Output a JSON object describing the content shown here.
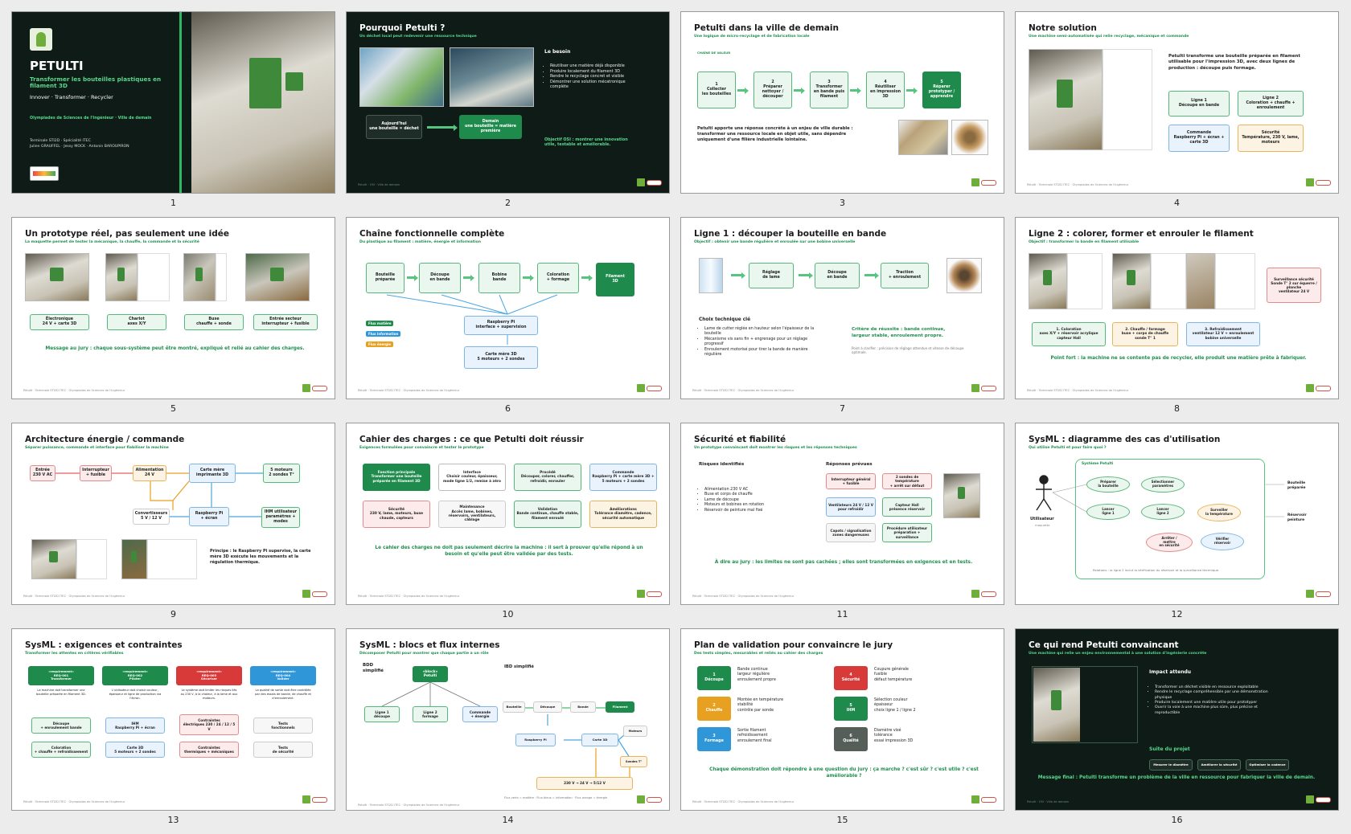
{
  "footer": "Petulti · Terminale STI2D ITEC · Olympiades de Sciences de l'Ingénieur",
  "slides": [
    {
      "num": "1",
      "title": "PETULTI",
      "subtitle": "Transformer les bouteilles plastiques en filament 3D",
      "tagline": "Innover · Transformer · Recycler",
      "event": "Olympiades de Sciences de l'Ingénieur · Ville de demain",
      "class": "Terminale STI2D · Spécialité ITEC",
      "authors": "Julien GRAUFFEL · Jessy MOCK · Antonin BAROUPIRON"
    },
    {
      "num": "2",
      "title": "Pourquoi Petulti ?",
      "subtitle": "Un déchet local peut redevenir une ressource technique",
      "need_title": "Le besoin",
      "need": [
        "Réutiliser une matière déjà disponible",
        "Produire localement du filament 3D",
        "Rendre le recyclage concret et visible",
        "Démontrer une solution mécatronique complète"
      ],
      "today": "Aujourd'hui\nune bouteille = déchet",
      "tomorrow": "Demain\nune bouteille = matière première",
      "osi": "Objectif OSI : montrer une innovation utile, testable et améliorable."
    },
    {
      "num": "3",
      "title": "Petulti dans la ville de demain",
      "subtitle": "Une logique de micro-recyclage et de fabrication locale",
      "chain_label": "CHAÎNE DE VALEUR",
      "steps": [
        "1\nCollecter\nles bouteilles",
        "2\nPréparer\nnettoyer / découper",
        "3\nTransformer\nen bande puis filament",
        "4\nRéutiliser\nen impression 3D",
        "5\nRéparer\nprototyper / apprendre"
      ],
      "text": "Petulti apporte une réponse concrète à un enjeu de ville durable : transformer une ressource locale en objet utile, sans dépendre uniquement d'une filière industrielle lointaine."
    },
    {
      "num": "4",
      "title": "Notre solution",
      "subtitle": "Une machine semi-automatisée qui relie recyclage, mécanique et commande",
      "text": "Petulti transforme une bouteille préparée en filament utilisable pour l'impression 3D, avec deux lignes de production : découpe puis formage.",
      "boxes": [
        "Ligne 1\nDécoupe en bande",
        "Ligne 2\nColoration + chauffe + enroulement",
        "Commande\nRaspberry Pi + écran + carte 3D",
        "Sécurité\nTempérature, 230 V, lame, moteurs"
      ]
    },
    {
      "num": "5",
      "title": "Un prototype réel, pas seulement une idée",
      "subtitle": "La maquette permet de tester la mécanique, la chauffe, la commande et la sécurité",
      "captions": [
        "Électronique\n24 V + carte 3D",
        "Chariot\naxes X/Y",
        "Buse\nchauffe + sonde",
        "Entrée secteur\ninterrupteur + fusible"
      ],
      "message": "Message au jury : chaque sous-système peut être montré, expliqué et relié au cahier des charges."
    },
    {
      "num": "6",
      "title": "Chaîne fonctionnelle complète",
      "subtitle": "Du plastique au filament : matière, énergie et information",
      "steps": [
        "Bouteille\npréparée",
        "Découpe\nen bande",
        "Bobine\nbande",
        "Coloration\n+ formage",
        "Filament\n3D"
      ],
      "rpi": "Raspberry Pi\ninterface + supervision",
      "card": "Carte mère 3D\n5 moteurs + 2 sondes",
      "legend": [
        "Flux matière",
        "Flux information",
        "Flux énergie"
      ]
    },
    {
      "num": "7",
      "title": "Ligne 1 : découper la bouteille en bande",
      "subtitle": "Objectif : obtenir une bande régulière et enroulée sur une bobine universelle",
      "steps": [
        "Réglage\nde lame",
        "Découpe\nen bande",
        "Traction\n+ enroulement"
      ],
      "choice_title": "Choix technique clé",
      "choices": [
        "Lame de cutter réglée en hauteur selon l'épaisseur de la bouteille",
        "Mécanisme vis sans fin + engrenage pour un réglage progressif",
        "Enroulement motorisé pour tirer la bande de manière régulière"
      ],
      "criterion": "Critère de réussite : bande continue, largeur stable, enroulement propre.",
      "clarify": "Point à clarifier : précision de réglage attendue et vitesse de découpe optimale."
    },
    {
      "num": "8",
      "title": "Ligne 2 : colorer, former et enrouler le filament",
      "subtitle": "Objectif : transformer la bande en filament utilisable",
      "captions": [
        "1. Coloration\naxes X/Y + réservoir acrylique\ncapteur Hall",
        "2. Chauffe / formage\nbuse + corps de chauffe\nsonde T° 1",
        "3. Refroidissement\nventilateur 12 V + enroulement\nbobine universelle"
      ],
      "safety": "Surveillance sécurité\nSonde T° 2 sur équerre / planche\nventilateur 24 V",
      "message": "Point fort : la machine ne se contente pas de recycler, elle produit une matière prête à fabriquer."
    },
    {
      "num": "9",
      "title": "Architecture énergie / commande",
      "subtitle": "Séparer puissance, commande et interface pour fiabiliser la machine",
      "boxes": [
        "Entrée\n230 V AC",
        "Interrupteur\n+ fusible",
        "Alimentation\n24 V",
        "Carte mère\nimprimante 3D",
        "5 moteurs\n2 sondes T°",
        "Convertisseurs\n5 V / 12 V",
        "Raspberry Pi\n+ écran",
        "IHM utilisateur\nparamètres + modes"
      ],
      "principle": "Principe : le Raspberry Pi supervise, la carte mère 3D exécute les mouvements et la régulation thermique."
    },
    {
      "num": "10",
      "title": "Cahier des charges : ce que Petulti doit réussir",
      "subtitle": "Exigences formulées pour convaincre et tester le prototype",
      "boxes": [
        "Fonction principale\nTransformer une bouteille préparée en filament 3D",
        "Interface\nChoisir couleur, épaisseur, mode ligne 1/2, remise à zéro",
        "Procédé\nDécouper, colorer, chauffer, refroidir, enrouler",
        "Commande\nRaspberry Pi + carte mère 3D + 5 moteurs + 2 sondes",
        "Sécurité\n230 V, lame, moteurs, buse chaude, capteurs",
        "Maintenance\nAccès lame, bobines, réservoirs, ventilateurs, câblage",
        "Validation\nBande continue, chauffe stable, filament enroulé",
        "Améliorations\nTolérance diamètre, cadence, sécurité automatique"
      ],
      "message": "Le cahier des charges ne doit pas seulement décrire la machine : il sert à prouver qu'elle répond à un besoin et qu'elle peut être validée par des tests."
    },
    {
      "num": "11",
      "title": "Sécurité et fiabilité",
      "subtitle": "Un prototype convaincant doit montrer les risques et les réponses techniques",
      "risks_title": "Risques identifiés",
      "risks": [
        "Alimentation 230 V AC",
        "Buse et corps de chauffe",
        "Lame de découpe",
        "Moteurs et bobines en rotation",
        "Réservoir de peinture mal fixé"
      ],
      "answers_title": "Réponses prévues",
      "answers": [
        "Interrupteur général\n+ fusible",
        "2 sondes de température\n+ arrêt sur défaut",
        "Ventilateurs 24 V / 12 V\npour refroidir",
        "Capteur Hall\nprésence réservoir",
        "Capots / signalisation\nzones dangereuses",
        "Procédure utilisateur\npréparation + surveillance"
      ],
      "message": "À dire au jury : les limites ne sont pas cachées ; elles sont transformées en exigences et en tests."
    },
    {
      "num": "12",
      "title": "SysML : diagramme des cas d'utilisation",
      "subtitle": "Qui utilise Petulti et pour faire quoi ?",
      "system": "Système Petulti",
      "actor": "Utilisateur",
      "actor_sub": "maquette",
      "cases": [
        "Préparer\nla bouteille",
        "Sélectionner\nparamètres",
        "Lancer\nligne 1",
        "Lancer\nligne 2",
        "Surveiller\nla température",
        "Arrêter /\nmettre\nen sécurité",
        "Vérifier\nréservoir"
      ],
      "outputs": [
        "Bouteille\npréparée",
        "Réservoir\npeinture"
      ],
      "relations": "Relations : la ligne 2 inclut la vérification du réservoir et la surveillance thermique."
    },
    {
      "num": "13",
      "title": "SysML : exigences et contraintes",
      "subtitle": "Transformer les attentes en critères vérifiables",
      "reqs": [
        {
          "head": "«requirement»\nREQ-001\nTransformer",
          "desc": "La machine doit transformer une bouteille préparée en filament 3D.",
          "a": "Découpe\n+ enroulement bande",
          "b": "Coloration\n+ chauffe + refroidissement",
          "c": "g"
        },
        {
          "head": "«requirement»\nREQ-002\nPiloter",
          "desc": "L'utilisateur doit choisir couleur, épaisseur et ligne de production via l'écran.",
          "a": "IHM\nRaspberry Pi + écran",
          "b": "Carte 3D\n5 moteurs + 2 sondes",
          "c": "g"
        },
        {
          "head": "«requirement»\nREQ-003\nSécuriser",
          "desc": "Le système doit limiter les risques liés au 230 V, à la chaleur, à la lame et aux moteurs.",
          "a": "Contraintes\nélectriques 230 / 24 / 12 / 5 V",
          "b": "Contraintes\nthermiques + mécaniques",
          "c": "r"
        },
        {
          "head": "«requirement»\nREQ-004\nValider",
          "desc": "La qualité de sortie doit être contrôlée par des essais de bande, de chauffe et d'enroulement.",
          "a": "Tests\nfonctionnels",
          "b": "Tests\nde sécurité",
          "c": "b"
        }
      ]
    },
    {
      "num": "14",
      "title": "SysML : blocs et flux internes",
      "subtitle": "Décomposer Petulti pour montrer que chaque partie a un rôle",
      "bdd": "BDD\nsimplifié",
      "block": "«block»\nPetulti",
      "parts": [
        "Ligne 1\ndécoupe",
        "Ligne 2\nformage",
        "Commande\n+ énergie"
      ],
      "ibd": "IBD simplifié",
      "flow": [
        "Bouteille",
        "Découpe",
        "Bande",
        "Filament"
      ],
      "rpi": "Raspberry Pi",
      "card": "Carte 3D",
      "motors": "Moteurs",
      "sondes": "Sondes T°",
      "power": "230 V → 24 V → 5/12 V",
      "legend": "Flux verts = matière · Flux bleus = information · Flux orange = énergie"
    },
    {
      "num": "15",
      "title": "Plan de validation pour convaincre le jury",
      "subtitle": "Des tests simples, mesurables et reliés au cahier des charges",
      "tests": [
        {
          "id": "1\nDécoupe",
          "lines": "Bande continue\nlargeur régulière\nenroulement propre",
          "color": "#1e8a4c"
        },
        {
          "id": "2\nChauffe",
          "lines": "Montée en température\nstabilité\ncontrôle par sonde",
          "color": "#e8a020"
        },
        {
          "id": "3\nFormage",
          "lines": "Sortie filament\nrefroidissement\nenroulement final",
          "color": "#2f96d8"
        },
        {
          "id": "4\nSécurité",
          "lines": "Coupure générale\nfusible\ndéfaut température",
          "color": "#d83a3a"
        },
        {
          "id": "5\nIHM",
          "lines": "Sélection couleur\népaisseur\nchoix ligne 1 / ligne 2",
          "color": "#1e8a4c"
        },
        {
          "id": "6\nQualité",
          "lines": "Diamètre visé\ntolérance\nessai impression 3D",
          "color": "#555e58"
        }
      ],
      "message": "Chaque démonstration doit répondre à une question du jury : ça marche ? c'est sûr ? c'est utile ? c'est améliorable ?"
    },
    {
      "num": "16",
      "title": "Ce qui rend Petulti convaincant",
      "subtitle": "Une machine qui relie un enjeu environnemental à une solution d'ingénierie concrète",
      "impact_title": "Impact attendu",
      "impact": [
        "Transformer un déchet visible en ressource exploitable",
        "Rendre le recyclage compréhensible par une démonstration physique",
        "Produire localement une matière utile pour prototyper",
        "Ouvrir la voie à une machine plus sûre, plus précise et reproductible"
      ],
      "next_title": "Suite du projet",
      "next": [
        "Mesurer le diamètre",
        "Améliorer la sécurité",
        "Optimiser la cadence"
      ],
      "message": "Message final : Petulti transforme un problème de la ville en ressource pour fabriquer la ville de demain.",
      "footer": "Petulti · OSI · Ville de demain"
    }
  ]
}
